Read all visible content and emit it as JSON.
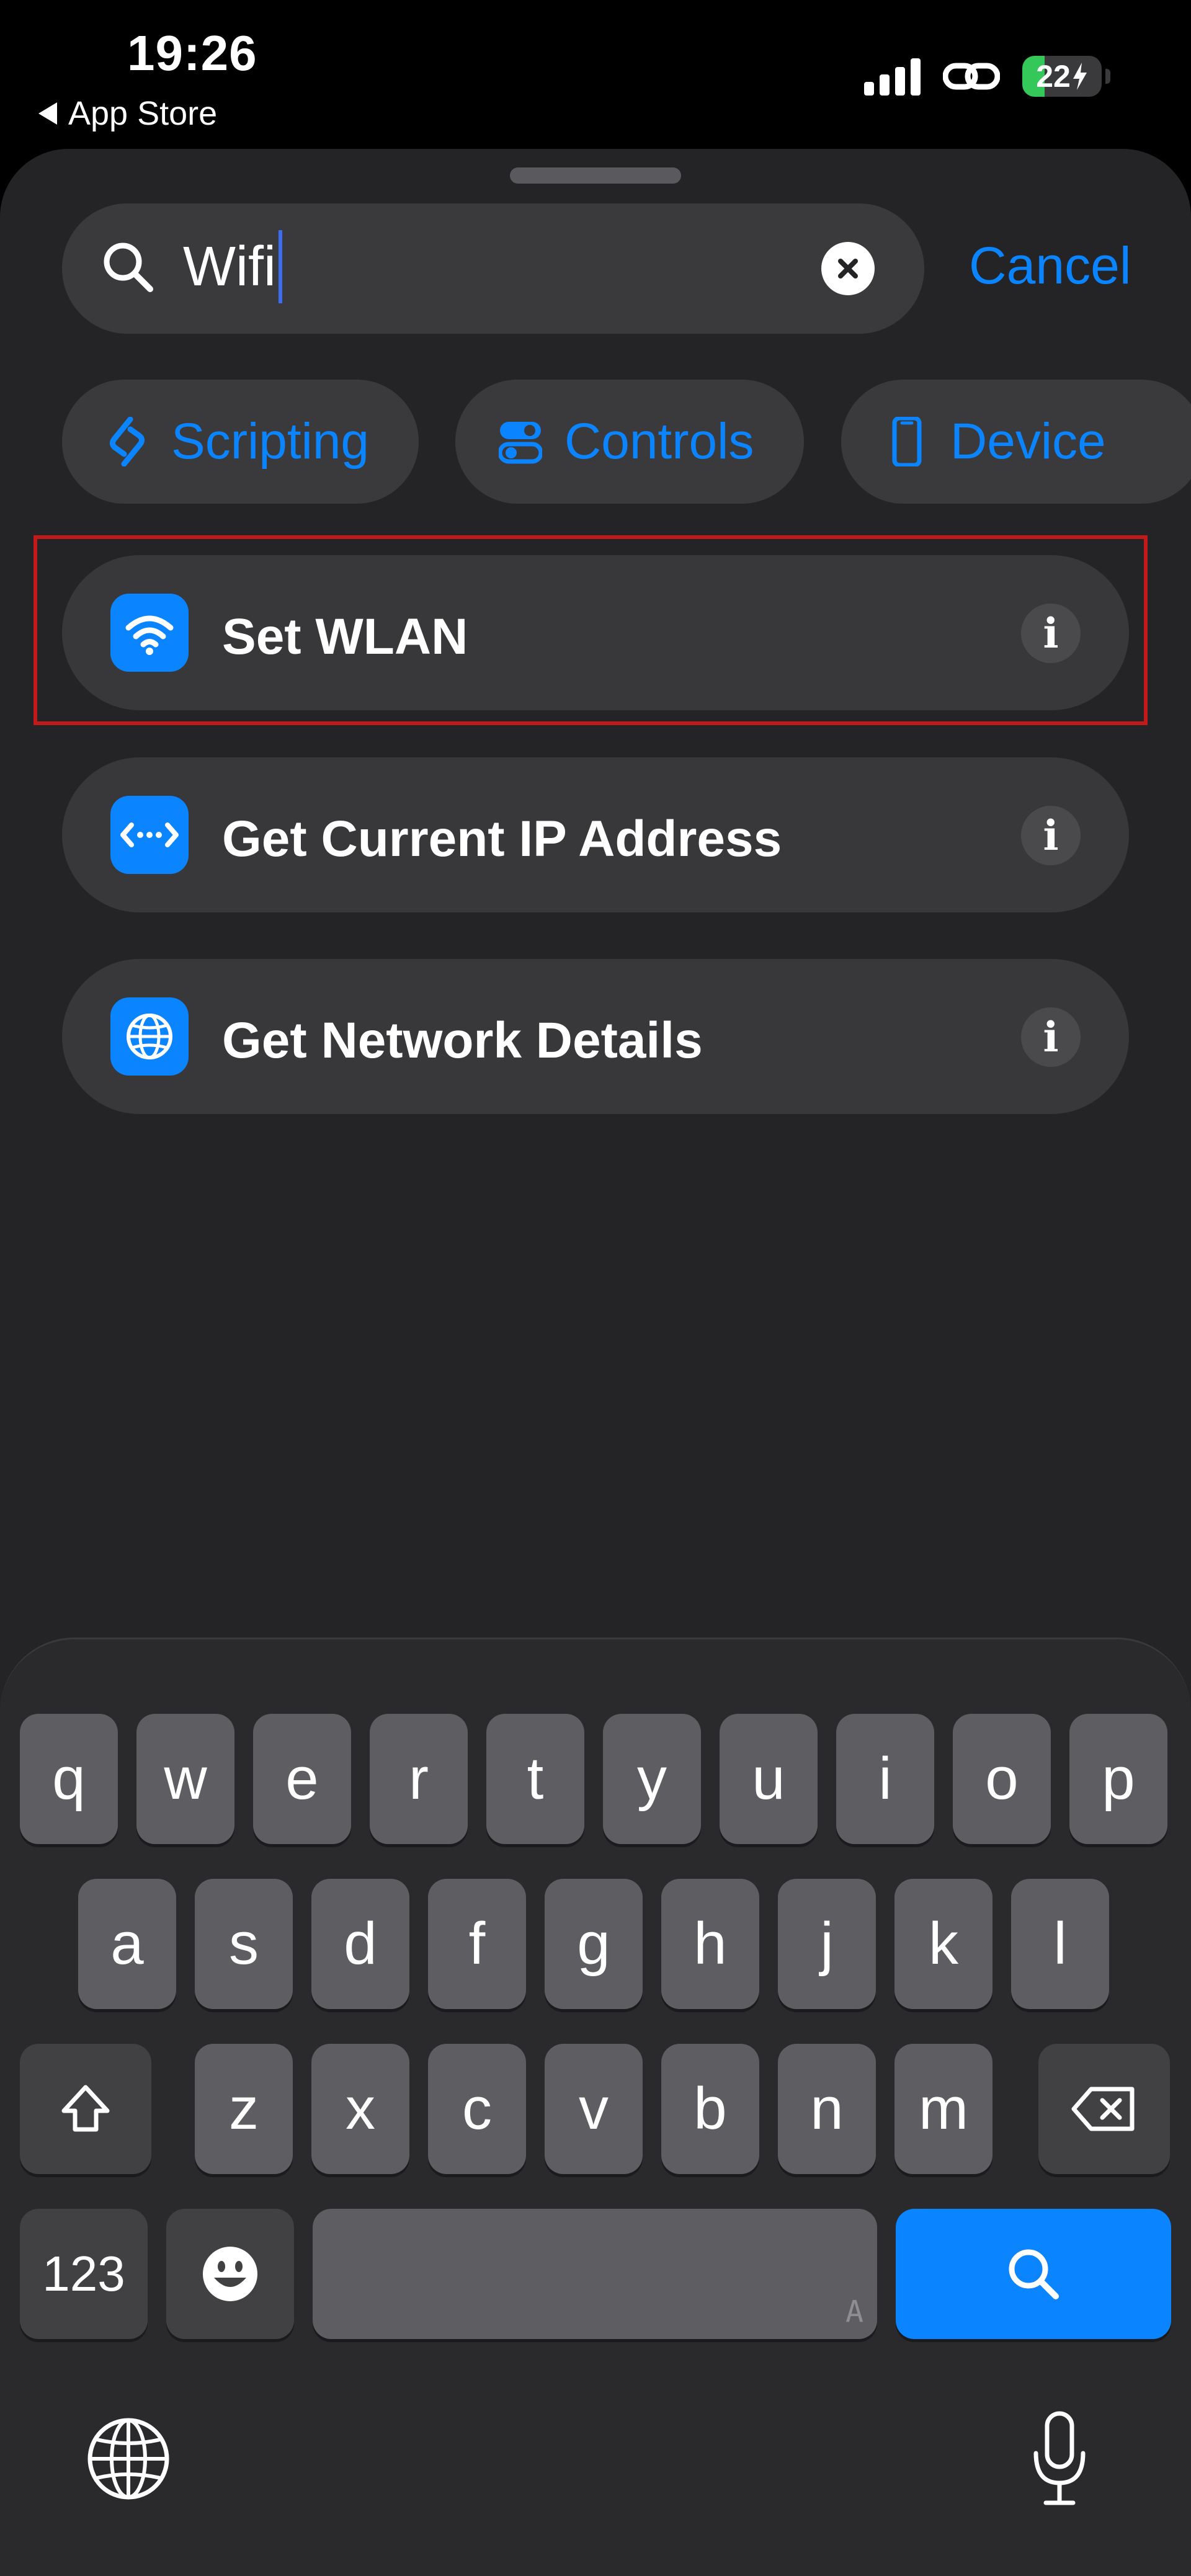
{
  "status_bar": {
    "time": "19:26",
    "back_label": "App Store",
    "battery_percent": "22",
    "battery_level": 0.22
  },
  "search": {
    "query": "Wifi",
    "cancel_label": "Cancel"
  },
  "categories": [
    {
      "label": "Scripting",
      "icon": "scripting-icon"
    },
    {
      "label": "Controls",
      "icon": "controls-icon"
    },
    {
      "label": "Device",
      "icon": "device-icon"
    }
  ],
  "results": [
    {
      "label": "Set WLAN",
      "icon": "wifi-icon",
      "highlighted": true
    },
    {
      "label": "Get Current IP Address",
      "icon": "ip-address-icon",
      "highlighted": false
    },
    {
      "label": "Get Network Details",
      "icon": "globe-icon",
      "highlighted": false
    }
  ],
  "keyboard": {
    "row1": [
      "q",
      "w",
      "e",
      "r",
      "t",
      "y",
      "u",
      "i",
      "o",
      "p"
    ],
    "row2": [
      "a",
      "s",
      "d",
      "f",
      "g",
      "h",
      "j",
      "k",
      "l"
    ],
    "row3": [
      "z",
      "x",
      "c",
      "v",
      "b",
      "n",
      "m"
    ],
    "numbers_label": "123",
    "space_alt": "A"
  },
  "colors": {
    "accent": "#0a84ff",
    "sheet_bg": "#242426",
    "highlight_border": "#c21a1a"
  }
}
